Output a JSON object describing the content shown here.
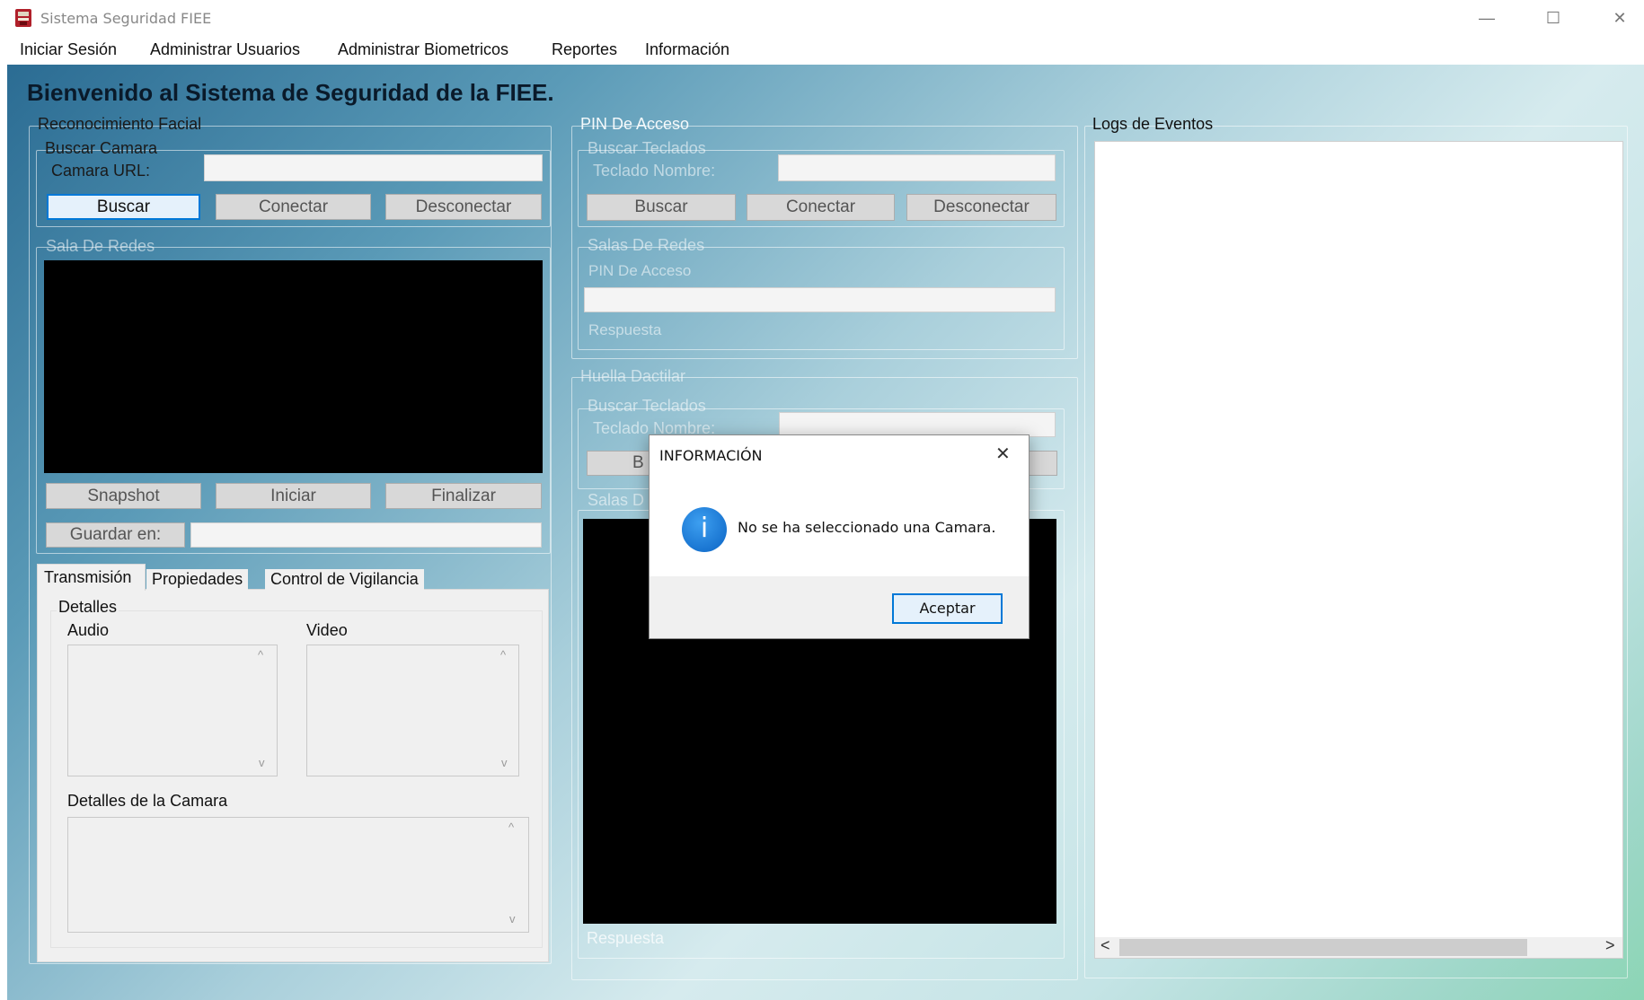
{
  "window": {
    "title": "Sistema Seguridad FIEE",
    "controls": {
      "minimize": "—",
      "maximize": "☐",
      "close": "✕"
    }
  },
  "menu": [
    "Iniciar Sesión",
    "Administrar Usuarios",
    "Administrar Biometricos",
    "Reportes",
    "Información"
  ],
  "main": {
    "title": "Bienvenido al Sistema de Seguridad de la FIEE."
  },
  "facial": {
    "group_label": "Reconocimiento Facial",
    "search_group": "Buscar Camara",
    "url_label": "Camara URL:",
    "url_value": "",
    "buttons": {
      "search": "Buscar",
      "connect": "Conectar",
      "disconnect": "Desconectar"
    },
    "room_group": "Sala De Redes",
    "video_buttons": {
      "snapshot": "Snapshot",
      "start": "Iniciar",
      "stop": "Finalizar"
    },
    "save_label": "Guardar en:",
    "save_value": "",
    "tabs": [
      "Transmisión",
      "Propiedades",
      "Control de Vigilancia"
    ],
    "details_group": "Detalles",
    "audio_label": "Audio",
    "video_label": "Video",
    "camera_details_label": "Detalles de la Camara"
  },
  "pin": {
    "group_label": "PIN De Acceso",
    "search_group": "Buscar Teclados",
    "keyboard_label": "Teclado Nombre:",
    "keyboard_value": "",
    "buttons": {
      "search": "Buscar",
      "connect": "Conectar",
      "disconnect": "Desconectar"
    },
    "rooms_group": "Salas De Redes",
    "pin_label": "PIN De Acceso",
    "pin_value": "",
    "response_label": "Respuesta"
  },
  "fingerprint": {
    "group_label": "Huella Dactilar",
    "search_group": "Buscar Teclados",
    "keyboard_label": "Teclado Nombre:",
    "keyboard_value": "",
    "search_button_partial": "B",
    "rooms_group_partial": "Salas D",
    "response_label": "Respuesta"
  },
  "logs": {
    "group_label": "Logs de Eventos",
    "scroll_left": "<",
    "scroll_right": ">"
  },
  "dialog": {
    "title": "INFORMACIÓN",
    "message": "No se ha seleccionado una Camara.",
    "ok_button": "Aceptar",
    "close_glyph": "✕",
    "icon_glyph": "i"
  },
  "icons": {
    "scroll_up": "^",
    "scroll_down": "v"
  }
}
